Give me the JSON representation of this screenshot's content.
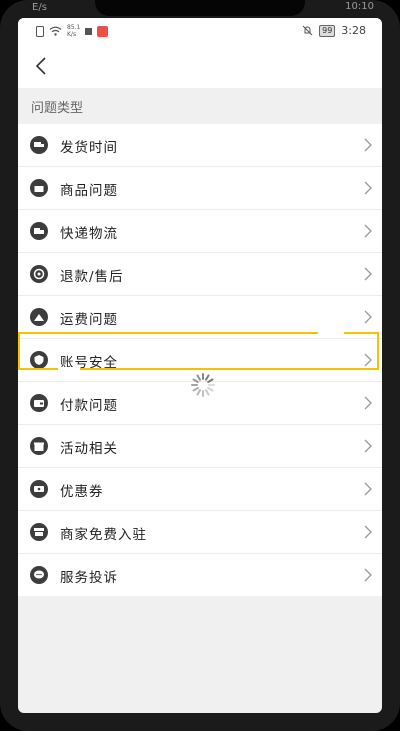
{
  "status_bar": {
    "network_speed_value": "85.1",
    "network_speed_unit": "K/s",
    "battery": "99",
    "time": "3:28"
  },
  "outer_ghost": {
    "left": "E/s",
    "right": "10:10"
  },
  "section": {
    "title": "问题类型"
  },
  "items": [
    {
      "label": "发货时间",
      "icon": "truck-icon"
    },
    {
      "label": "商品问题",
      "icon": "box-icon"
    },
    {
      "label": "快递物流",
      "icon": "delivery-icon"
    },
    {
      "label": "退款/售后",
      "icon": "refund-icon"
    },
    {
      "label": "运费问题",
      "icon": "shipping-fee-icon"
    },
    {
      "label": "账号安全",
      "icon": "shield-icon"
    },
    {
      "label": "付款问题",
      "icon": "wallet-icon"
    },
    {
      "label": "活动相关",
      "icon": "gift-icon"
    },
    {
      "label": "优惠券",
      "icon": "coupon-icon"
    },
    {
      "label": "商家免费入驻",
      "icon": "store-icon"
    },
    {
      "label": "服务投诉",
      "icon": "chat-icon"
    }
  ],
  "colors": {
    "highlight": "#f5c400",
    "icon_bg": "#3d3d3d",
    "background": "#f0f0f0"
  }
}
